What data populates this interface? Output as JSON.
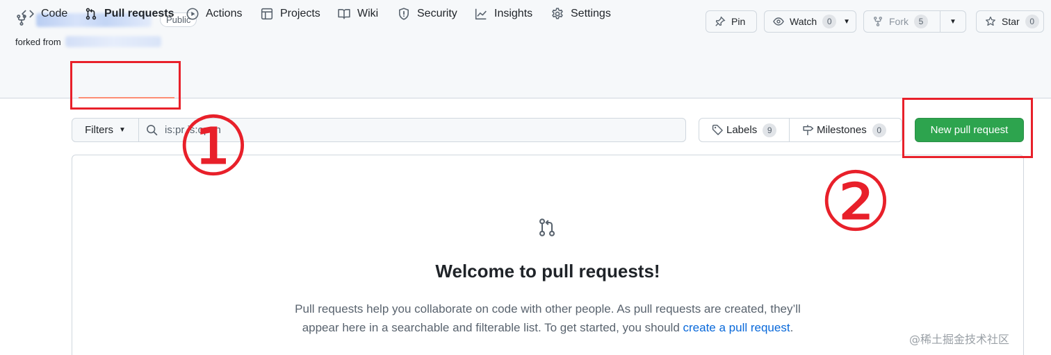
{
  "repo": {
    "visibility_badge": "Public",
    "forked_from_label": "forked from"
  },
  "header_actions": {
    "pin_label": "Pin",
    "watch_label": "Watch",
    "watch_count": "0",
    "fork_label": "Fork",
    "fork_count": "5",
    "star_label": "Star",
    "star_count": "0"
  },
  "tabs": [
    {
      "label": "Code",
      "icon": "code-icon"
    },
    {
      "label": "Pull requests",
      "icon": "git-pull-request-icon",
      "active": true
    },
    {
      "label": "Actions",
      "icon": "play-icon"
    },
    {
      "label": "Projects",
      "icon": "table-icon"
    },
    {
      "label": "Wiki",
      "icon": "book-icon"
    },
    {
      "label": "Security",
      "icon": "shield-icon"
    },
    {
      "label": "Insights",
      "icon": "graph-icon"
    },
    {
      "label": "Settings",
      "icon": "gear-icon"
    }
  ],
  "toolbar": {
    "filters_label": "Filters",
    "search_value": "is:pr is:open",
    "labels_label": "Labels",
    "labels_count": "9",
    "milestones_label": "Milestones",
    "milestones_count": "0",
    "new_pr_label": "New pull request"
  },
  "blankslate": {
    "title": "Welcome to pull requests!",
    "desc_line1": "Pull requests help you collaborate on code with other people. As pull requests are created, they’ll",
    "desc_line2_prefix": "appear here in a searchable and filterable list. To get started, you should",
    "desc_link": "create a pull request",
    "desc_suffix": "."
  },
  "annotations": {
    "marker_1": "①",
    "marker_2": "②",
    "color": "#e8202a"
  },
  "watermark": "@稀土掘金技术社区",
  "colors": {
    "primary_green": "#2da44e",
    "link_blue": "#0969da",
    "active_tab_underline": "#fd8c73"
  }
}
